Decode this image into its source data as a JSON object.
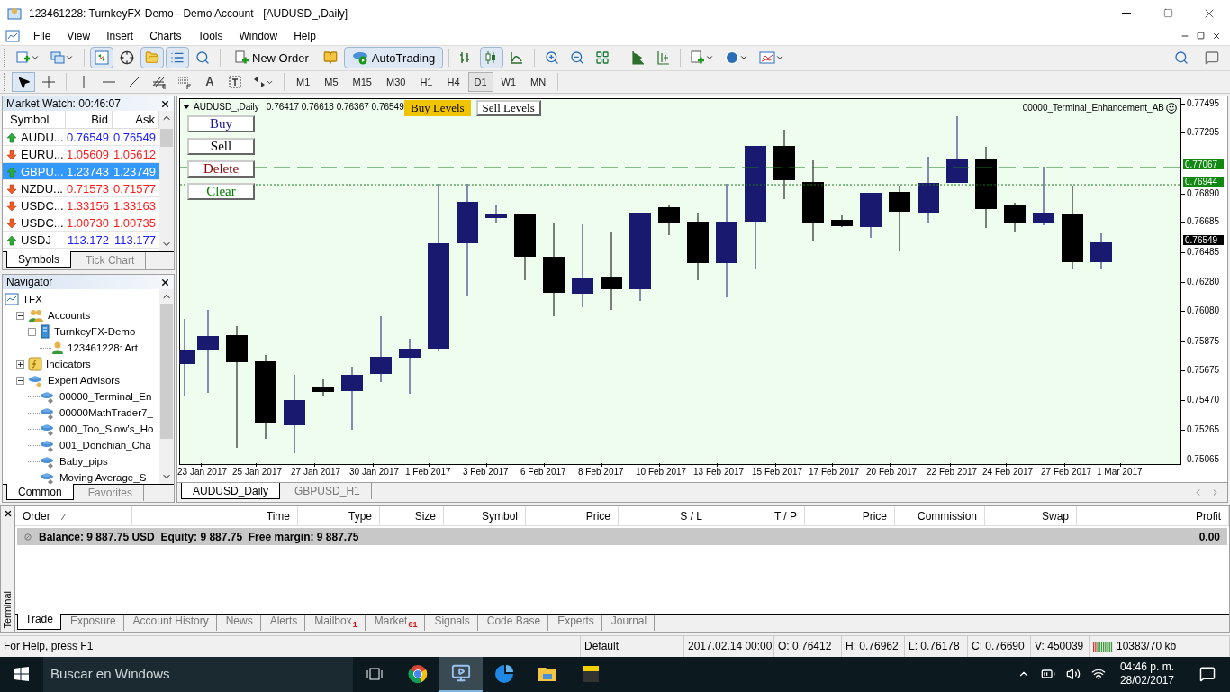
{
  "window": {
    "title": "123461228: TurnkeyFX-Demo - Demo Account - [AUDUSD_,Daily]"
  },
  "menu": [
    "File",
    "View",
    "Insert",
    "Charts",
    "Tools",
    "Window",
    "Help"
  ],
  "toolbar": [
    {
      "kind": "icon",
      "pressed": false
    },
    {
      "kind": "icon",
      "pressed": false
    },
    {
      "kind": "sep"
    },
    {
      "kind": "icon",
      "pressed": true
    },
    {
      "kind": "icon",
      "pressed": false
    },
    {
      "kind": "icon",
      "pressed": true
    },
    {
      "kind": "icon",
      "pressed": true
    },
    {
      "kind": "icon",
      "pressed": false
    },
    {
      "kind": "sep"
    },
    {
      "kind": "button",
      "label": "New Order",
      "pressed": false
    },
    {
      "kind": "icon",
      "pressed": false
    },
    {
      "kind": "button",
      "label": "AutoTrading",
      "pressed": true
    },
    {
      "kind": "sep"
    },
    {
      "kind": "icon",
      "pressed": false
    },
    {
      "kind": "icon",
      "pressed": true
    },
    {
      "kind": "icon",
      "pressed": false
    },
    {
      "kind": "sep"
    },
    {
      "kind": "icon",
      "pressed": false
    },
    {
      "kind": "icon",
      "pressed": false
    },
    {
      "kind": "icon",
      "pressed": false
    },
    {
      "kind": "sep"
    },
    {
      "kind": "icon",
      "pressed": false
    },
    {
      "kind": "icon",
      "pressed": false
    },
    {
      "kind": "sep"
    },
    {
      "kind": "icon",
      "pressed": false
    },
    {
      "kind": "icon",
      "pressed": false
    },
    {
      "kind": "icon",
      "pressed": false
    }
  ],
  "drawing_tools": [
    {
      "kind": "tool",
      "pressed": true
    },
    {
      "kind": "tool",
      "pressed": false
    },
    {
      "kind": "sep"
    },
    {
      "kind": "tool",
      "pressed": false
    },
    {
      "kind": "tool",
      "pressed": false
    },
    {
      "kind": "tool",
      "pressed": false
    },
    {
      "kind": "tool",
      "pressed": false
    },
    {
      "kind": "tool",
      "pressed": false
    },
    {
      "kind": "text",
      "label": "A",
      "pressed": false
    },
    {
      "kind": "tool",
      "pressed": false
    },
    {
      "kind": "tool",
      "pressed": false
    }
  ],
  "timeframes": [
    {
      "label": "M1",
      "selected": false
    },
    {
      "label": "M5",
      "selected": false
    },
    {
      "label": "M15",
      "selected": false
    },
    {
      "label": "M30",
      "selected": false
    },
    {
      "label": "H1",
      "selected": false
    },
    {
      "label": "H4",
      "selected": false
    },
    {
      "label": "D1",
      "selected": true
    },
    {
      "label": "W1",
      "selected": false
    },
    {
      "label": "MN",
      "selected": false
    }
  ],
  "market_watch": {
    "title": "Market Watch: 00:46:07",
    "columns": [
      "Symbol",
      "Bid",
      "Ask"
    ],
    "rows": [
      {
        "symbol": "AUDU...",
        "bid": "0.76549",
        "ask": "0.76549",
        "rising": true,
        "selected": false
      },
      {
        "symbol": "EURU...",
        "bid": "1.05609",
        "ask": "1.05612",
        "rising": false,
        "selected": false
      },
      {
        "symbol": "GBPU...",
        "bid": "1.23743",
        "ask": "1.23749",
        "rising": true,
        "selected": true
      },
      {
        "symbol": "NZDU...",
        "bid": "0.71573",
        "ask": "0.71577",
        "rising": false,
        "selected": false
      },
      {
        "symbol": "USDC...",
        "bid": "1.33156",
        "ask": "1.33163",
        "rising": false,
        "selected": false
      },
      {
        "symbol": "USDC...",
        "bid": "1.00730",
        "ask": "1.00735",
        "rising": false,
        "selected": false
      },
      {
        "symbol": "USDJ",
        "bid": "113.172",
        "ask": "113.177",
        "rising": true,
        "selected": false
      }
    ],
    "tabs": [
      {
        "label": "Symbols",
        "selected": true
      },
      {
        "label": "Tick Chart",
        "selected": false
      }
    ]
  },
  "navigator": {
    "title": "Navigator",
    "tree": [
      {
        "label": "TFX",
        "kind": "root",
        "children": [
          {
            "label": "Accounts",
            "kind": "accounts",
            "expanded": true,
            "children": [
              {
                "label": "TurnkeyFX-Demo",
                "kind": "server",
                "expanded": true,
                "children": [
                  {
                    "label": "123461228: Art",
                    "kind": "user"
                  }
                ]
              }
            ]
          },
          {
            "label": "Indicators",
            "kind": "indicators",
            "expanded": false
          },
          {
            "label": "Expert Advisors",
            "kind": "experts",
            "expanded": true,
            "children": [
              {
                "label": "00000_Terminal_En",
                "kind": "expert"
              },
              {
                "label": "00000MathTrader7_",
                "kind": "expert"
              },
              {
                "label": "000_Too_Slow's_Ho",
                "kind": "expert"
              },
              {
                "label": "001_Donchian_Cha",
                "kind": "expert"
              },
              {
                "label": "Baby_pips",
                "kind": "expert"
              },
              {
                "label": "Moving Average_S",
                "kind": "expert"
              }
            ]
          }
        ]
      }
    ],
    "tabs": [
      {
        "label": "Common",
        "selected": true
      },
      {
        "label": "Favorites",
        "selected": false
      }
    ]
  },
  "chart": {
    "symbol": "AUDUSD_,Daily",
    "ohlc": "0.76417 0.76618 0.76367 0.76549",
    "level_buttons": [
      {
        "label": "Buy Levels",
        "selected": true
      },
      {
        "label": "Sell Levels",
        "selected": false
      }
    ],
    "trade_buttons": [
      {
        "label": "Buy",
        "color": "#1a1a8c"
      },
      {
        "label": "Sell",
        "color": "#000000"
      },
      {
        "label": "Delete",
        "color": "#8b0000"
      },
      {
        "label": "Clear",
        "color": "#008000"
      }
    ],
    "expert_label": "00000_Terminal_Enhancement_AB",
    "price_ticks": [
      "0.77495",
      "0.77295",
      "0.76890",
      "0.76685",
      "0.76485",
      "0.76280",
      "0.76080",
      "0.75875",
      "0.75675",
      "0.75470",
      "0.75265",
      "0.75065"
    ],
    "price_markers": [
      {
        "label": "0.77067",
        "kind": "level"
      },
      {
        "label": "0.76944",
        "kind": "level"
      },
      {
        "label": "0.76549",
        "kind": "bid"
      }
    ],
    "dates": [
      "23 Jan 2017",
      "25 Jan 2017",
      "27 Jan 2017",
      "30 Jan 2017",
      "1 Feb 2017",
      "3 Feb 2017",
      "6 Feb 2017",
      "8 Feb 2017",
      "10 Feb 2017",
      "13 Feb 2017",
      "15 Feb 2017",
      "17 Feb 2017",
      "20 Feb 2017",
      "22 Feb 2017",
      "24 Feb 2017",
      "27 Feb 2017",
      "1 Mar 2017"
    ],
    "tabs": [
      {
        "label": "AUDUSD_Daily",
        "selected": true
      },
      {
        "label": "GBPUSD_H1",
        "selected": false
      }
    ]
  },
  "terminal": {
    "title": "Terminal",
    "columns": [
      "Order",
      "Time",
      "Type",
      "Size",
      "Symbol",
      "Price",
      "S / L",
      "T / P",
      "Price",
      "Commission",
      "Swap",
      "Profit"
    ],
    "balance": "Balance: 9 887.75 USD  Equity: 9 887.75  Free margin: 9 887.75",
    "profit": "0.00",
    "tabs": [
      {
        "label": "Trade",
        "selected": true
      },
      {
        "label": "Exposure",
        "selected": false
      },
      {
        "label": "Account History",
        "selected": false
      },
      {
        "label": "News",
        "selected": false
      },
      {
        "label": "Alerts",
        "selected": false
      },
      {
        "label": "Mailbox",
        "badge": "1",
        "selected": false
      },
      {
        "label": "Market",
        "badge": "61",
        "selected": false
      },
      {
        "label": "Signals",
        "selected": false
      },
      {
        "label": "Code Base",
        "selected": false
      },
      {
        "label": "Experts",
        "selected": false
      },
      {
        "label": "Journal",
        "selected": false
      }
    ]
  },
  "status_bar": [
    "For Help, press F1",
    "Default",
    "2017.02.14 00:00",
    "O: 0.76412",
    "H: 0.76962",
    "L: 0.76178",
    "C: 0.76690",
    "V: 450039",
    "10383/70 kb"
  ],
  "taskbar": {
    "search": "Buscar en Windows",
    "time": "04:46 p. m.",
    "date": "28/02/2017"
  }
}
